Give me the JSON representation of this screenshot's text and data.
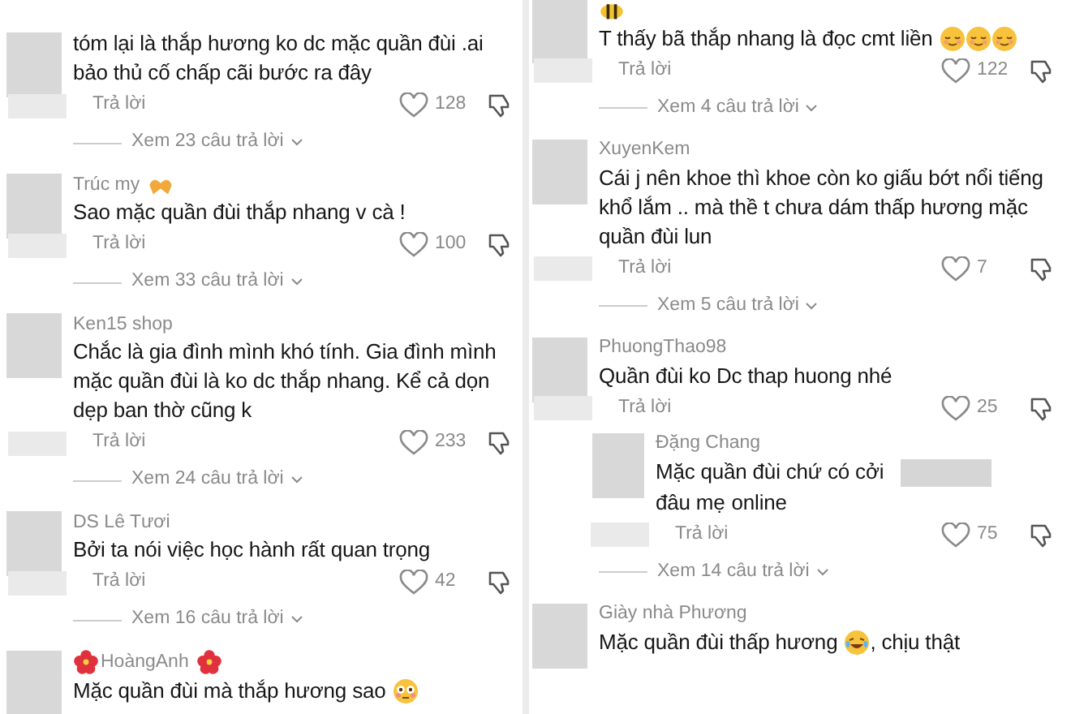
{
  "panels": [
    {
      "comments": [
        {
          "text": [
            {
              "kind": "text",
              "text": "tóm lại là thắp hương ko dc mặc quần đùi .ai bảo thủ cố chấp cãi bước ra đây"
            }
          ],
          "reply_label": "Trả lời",
          "likes": "128",
          "view_replies": "Xem 23 câu trả lời"
        },
        {
          "author": [
            {
              "kind": "text",
              "text": "Trúc my"
            },
            {
              "kind": "hands"
            }
          ],
          "text": [
            {
              "kind": "text",
              "text": "Sao mặc quần đùi thắp nhang v cà !"
            }
          ],
          "reply_label": "Trả lời",
          "likes": "100",
          "view_replies": "Xem 33 câu trả lời"
        },
        {
          "author": [
            {
              "kind": "text",
              "text": "Ken15 shop"
            }
          ],
          "text": [
            {
              "kind": "text",
              "text": "Chắc là gia đình mình khó tính. Gia đình mình mặc quần đùi là ko dc thắp nhang. Kể cả dọn dẹp ban thờ cũng k"
            }
          ],
          "reply_label": "Trả lời",
          "likes": "233",
          "view_replies": "Xem 24 câu trả lời"
        },
        {
          "author": [
            {
              "kind": "text",
              "text": "DS Lê Tươi"
            }
          ],
          "text": [
            {
              "kind": "text",
              "text": "Bởi ta nói việc học hành rất quan trọng"
            }
          ],
          "reply_label": "Trả lời",
          "likes": "42",
          "view_replies": "Xem 16 câu trả lời"
        },
        {
          "author": [
            {
              "kind": "flower"
            },
            {
              "kind": "text",
              "text": "HoàngAnh"
            },
            {
              "kind": "flower"
            }
          ],
          "text": [
            {
              "kind": "text",
              "text": "Mặc quần đùi mà thắp hương sao"
            },
            {
              "kind": "flushed"
            }
          ]
        }
      ]
    },
    {
      "comments": [
        {
          "author": [
            {
              "kind": "bee"
            }
          ],
          "text": [
            {
              "kind": "text",
              "text": "T thấy bã thắp nhang là đọc cmt liền"
            },
            {
              "kind": "relieved"
            },
            {
              "kind": "relieved"
            },
            {
              "kind": "relieved"
            }
          ],
          "reply_label": "Trả lời",
          "likes": "122",
          "view_replies": "Xem 4 câu trả lời"
        },
        {
          "author": [
            {
              "kind": "text",
              "text": "XuyenKem"
            }
          ],
          "text": [
            {
              "kind": "text",
              "text": "Cái j nên khoe thì khoe còn ko giấu bớt nổi tiếng khổ lắm .. mà thề t chưa dám thấp hương mặc quần đùi lun"
            }
          ],
          "reply_label": "Trả lời",
          "likes": "7",
          "view_replies": "Xem 5 câu trả lời"
        },
        {
          "author": [
            {
              "kind": "text",
              "text": "PhuongThao98"
            }
          ],
          "text": [
            {
              "kind": "text",
              "text": "Quần đùi ko Dc thap huong nhé"
            }
          ],
          "reply_label": "Trả lời",
          "likes": "25",
          "replies": [
            {
              "author": [
                {
                  "kind": "text",
                  "text": "Đặng Chang"
                }
              ],
              "text": [
                {
                  "kind": "text",
                  "text": "Mặc quần đùi chứ có cởi"
                },
                {
                  "kind": "blur"
                },
                {
                  "kind": "text",
                  "text": "đâu mẹ"
                },
                {
                  "kind": "text",
                  "text": "online"
                }
              ],
              "reply_label": "Trả lời",
              "likes": "75"
            }
          ],
          "view_replies": "Xem 14 câu trả lời"
        },
        {
          "author": [
            {
              "kind": "text",
              "text": "Giày nhà Phương"
            }
          ],
          "text": [
            {
              "kind": "text",
              "text": "Mặc quần đùi thấp hương"
            },
            {
              "kind": "laughing"
            },
            {
              "kind": "text",
              "text": ", chịu thật"
            }
          ]
        }
      ]
    }
  ]
}
